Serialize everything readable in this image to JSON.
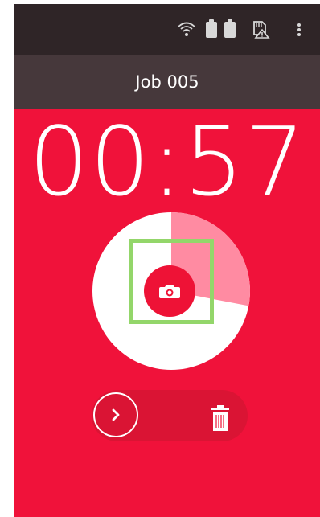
{
  "app": {
    "title": "Job 005",
    "timer": "00:57"
  },
  "status_bar": {
    "icons": [
      "wifi-icon",
      "battery-icon",
      "battery-icon",
      "sd-card-warning-icon",
      "overflow-menu-icon"
    ]
  },
  "progress": {
    "elapsed_fraction": 0.28
  },
  "actions": {
    "camera_icon": "camera-icon",
    "next_icon": "chevron-right-icon",
    "delete_icon": "trash-icon"
  },
  "colors": {
    "background": "#f0123a",
    "status_bar": "#2f2527",
    "title_bar": "#46383b",
    "progress_remaining": "#ffffff",
    "progress_elapsed": "#ff8ba2",
    "focus_outline": "#93d66a"
  }
}
